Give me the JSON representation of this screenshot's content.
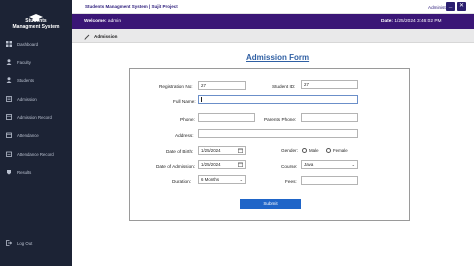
{
  "sidebar": {
    "title": "Students Managment System",
    "items": [
      {
        "label": "Dashboard",
        "icon": "dashboard-icon"
      },
      {
        "label": "Faculty",
        "icon": "faculty-icon"
      },
      {
        "label": "Students",
        "icon": "students-icon"
      },
      {
        "label": "Admission",
        "icon": "admission-icon"
      },
      {
        "label": "Admission Record",
        "icon": "admission-record-icon"
      },
      {
        "label": "Attendance",
        "icon": "attendance-icon"
      },
      {
        "label": "Attendance Record",
        "icon": "attendance-record-icon"
      },
      {
        "label": "Results",
        "icon": "results-icon"
      }
    ],
    "logout": {
      "label": "Log Out",
      "icon": "logout-icon"
    }
  },
  "topbar": {
    "title": "Students Managment System | Sujit Project",
    "role": "Administrator",
    "minimize": "_",
    "close": "✕"
  },
  "welcomebar": {
    "welcome_label": "Welcome:",
    "user": "admin",
    "date_label": "Date:",
    "datetime": "1/25/2024 3:46:02 PM"
  },
  "breadcrumb": {
    "label": "Admission"
  },
  "form": {
    "heading": "Admission Form",
    "registration_no": {
      "label": "Registration No:",
      "value": "27"
    },
    "student_id": {
      "label": "Student ID:",
      "value": "27"
    },
    "full_name": {
      "label": "Full Name:",
      "value": ""
    },
    "phone": {
      "label": "Phone:",
      "value": ""
    },
    "parents_phone": {
      "label": "Parents Phone:",
      "value": ""
    },
    "address": {
      "label": "Address:",
      "value": ""
    },
    "dob": {
      "label": "Date of Birth:",
      "value": "1/25/2024"
    },
    "gender": {
      "label": "Gender:",
      "options": [
        "Male",
        "Female"
      ]
    },
    "doa": {
      "label": "Date of Admission:",
      "value": "1/25/2024"
    },
    "course": {
      "label": "Course:",
      "value": "Java"
    },
    "duration": {
      "label": "Duration:",
      "value": "6 Months"
    },
    "fees": {
      "label": "Fees:",
      "value": ""
    },
    "submit": "Submit"
  },
  "colors": {
    "sidebar": "#1c2335",
    "header_bar": "#3a1676",
    "accent": "#1f65c8",
    "heading": "#2f5fa3"
  }
}
